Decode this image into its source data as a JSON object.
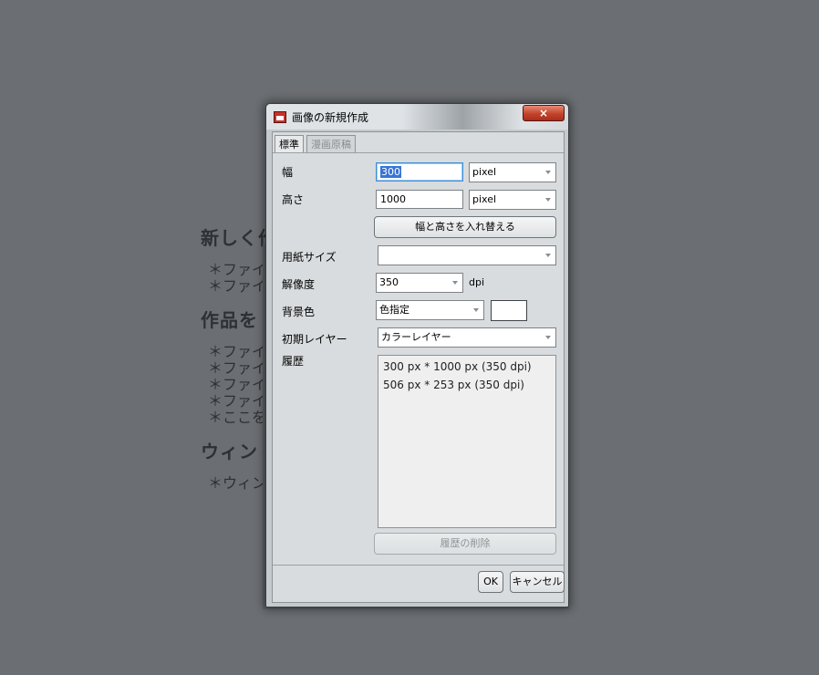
{
  "background": {
    "sections": [
      {
        "heading": "新しく作",
        "items": [
          "＊ファイル",
          "＊ファイル"
        ]
      },
      {
        "heading": "作品を",
        "items": [
          "＊ファイル",
          "＊ファイル",
          "＊ファイル",
          "＊ファイル",
          "＊ここをタ"
        ]
      },
      {
        "heading": "ウィンド",
        "items": [
          "＊ウィンド"
        ]
      }
    ]
  },
  "dialog": {
    "title": "画像の新規作成",
    "close_label": "×",
    "tabs": [
      {
        "label": "標準",
        "active": true
      },
      {
        "label": "漫画原稿",
        "active": false
      }
    ],
    "width": {
      "label": "幅",
      "value": "300",
      "unit": "pixel"
    },
    "height": {
      "label": "高さ",
      "value": "1000",
      "unit": "pixel"
    },
    "swap_button": "幅と高さを入れ替える",
    "paper_size": {
      "label": "用紙サイズ",
      "value": ""
    },
    "resolution": {
      "label": "解像度",
      "value": "350",
      "unit": "dpi"
    },
    "background_color": {
      "label": "背景色",
      "value": "色指定",
      "swatch_color": "#ffffff"
    },
    "initial_layer": {
      "label": "初期レイヤー",
      "value": "カラーレイヤー"
    },
    "history": {
      "label": "履歴",
      "items": [
        "300 px * 1000 px (350 dpi)",
        "506 px * 253 px (350 dpi)"
      ],
      "clear_button": "履歴の削除"
    },
    "ok_button": "OK",
    "cancel_button": "キャンセル"
  }
}
